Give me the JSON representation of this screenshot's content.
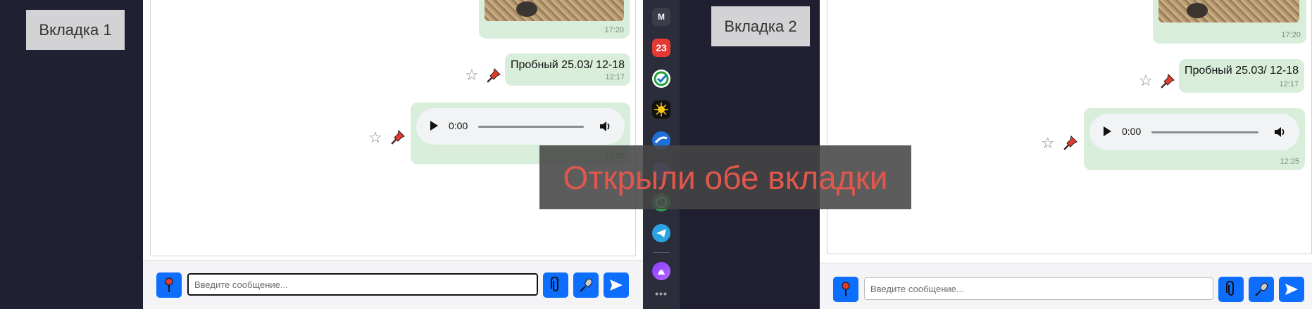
{
  "tab1": {
    "label": "Вкладка 1"
  },
  "tab2": {
    "label": "Вкладка 2"
  },
  "overlay": {
    "text": "Открыли обе вкладки",
    "color": "#e2574c"
  },
  "chat": {
    "photo_time": "17:20",
    "text_message": "Пробный 25.03/ 12-18",
    "text_time": "12:17",
    "audio_time_display": "0:00",
    "audio_msg_time": "12:25",
    "input_placeholder": "Введите сообщение..."
  },
  "dock": {
    "items": [
      {
        "name": "M",
        "icon": "mail-icon"
      },
      {
        "name": "23",
        "icon": "calendar-icon"
      },
      {
        "name": "",
        "icon": "check-app-icon"
      },
      {
        "name": "",
        "icon": "star-burst-icon"
      },
      {
        "name": "",
        "icon": "circle-app-icon"
      },
      {
        "name": "",
        "icon": "purple-app-icon"
      },
      {
        "name": "",
        "icon": "whatsapp-icon"
      },
      {
        "name": "",
        "icon": "telegram-icon"
      },
      {
        "name": "",
        "icon": "alice-icon"
      },
      {
        "name": "•••",
        "icon": "more-icon"
      }
    ]
  },
  "colors": {
    "bubble": "#d8eedb",
    "button": "#0d6efd",
    "dark_bg": "#202033"
  }
}
